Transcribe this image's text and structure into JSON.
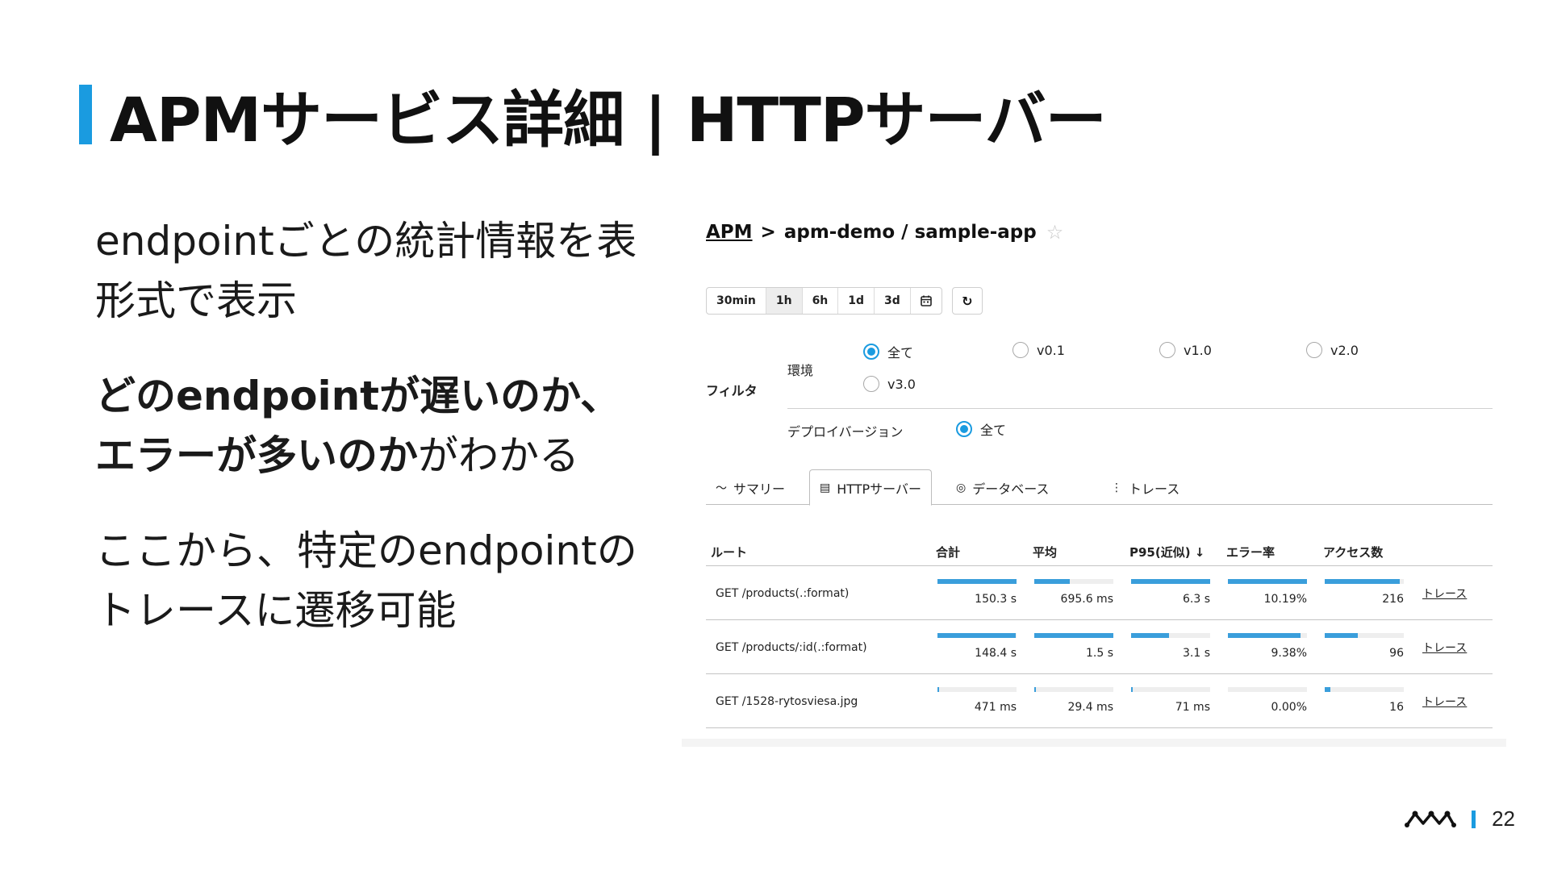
{
  "title": "APMサービス詳細 | HTTPサーバー",
  "paragraphs": {
    "p1": "endpointごとの統計情報を表形式で表示",
    "p2_bold": "どのendpointが遅いのか、エラーが多いのか",
    "p2_rest": "がわかる",
    "p3": "ここから、特定のendpointのトレースに遷移可能"
  },
  "breadcrumb": {
    "root": "APM",
    "path": "apm-demo / sample-app"
  },
  "time_ranges": [
    "30min",
    "1h",
    "6h",
    "1d",
    "3d"
  ],
  "time_selected": "1h",
  "filter": {
    "label": "フィルタ",
    "env_label": "環境",
    "env_options": [
      "全て",
      "v0.1",
      "v1.0",
      "v2.0",
      "v3.0"
    ],
    "env_selected": "全て",
    "deploy_label": "デプロイバージョン",
    "deploy_options": [
      "全て"
    ]
  },
  "tabs": [
    "サマリー",
    "HTTPサーバー",
    "データベース",
    "トレース"
  ],
  "active_tab": "HTTPサーバー",
  "table": {
    "headers": [
      "ルート",
      "合計",
      "平均",
      "P95(近似) ↓",
      "エラー率",
      "アクセス数"
    ],
    "rows": [
      {
        "route": "GET /products(.:format)",
        "total": "150.3 s",
        "avg": "695.6 ms",
        "p95": "6.3 s",
        "err": "10.19%",
        "count": "216",
        "link": "トレース",
        "fills": {
          "total": 1.0,
          "avg": 0.45,
          "p95": 1.0,
          "err": 1.0,
          "count": 0.95
        }
      },
      {
        "route": "GET /products/:id(.:format)",
        "total": "148.4 s",
        "avg": "1.5 s",
        "p95": "3.1 s",
        "err": "9.38%",
        "count": "96",
        "link": "トレース",
        "fills": {
          "total": 0.99,
          "avg": 1.0,
          "p95": 0.48,
          "err": 0.92,
          "count": 0.42
        }
      },
      {
        "route": "GET /1528-rytosviesa.jpg",
        "total": "471 ms",
        "avg": "29.4 ms",
        "p95": "71 ms",
        "err": "0.00%",
        "count": "16",
        "link": "トレース",
        "fills": {
          "total": 0.01,
          "avg": 0.02,
          "p95": 0.01,
          "err": 0.0,
          "count": 0.07
        }
      }
    ]
  },
  "page_number": "22",
  "colors": {
    "accent": "#1a9be0",
    "bar": "#3a9edb"
  }
}
